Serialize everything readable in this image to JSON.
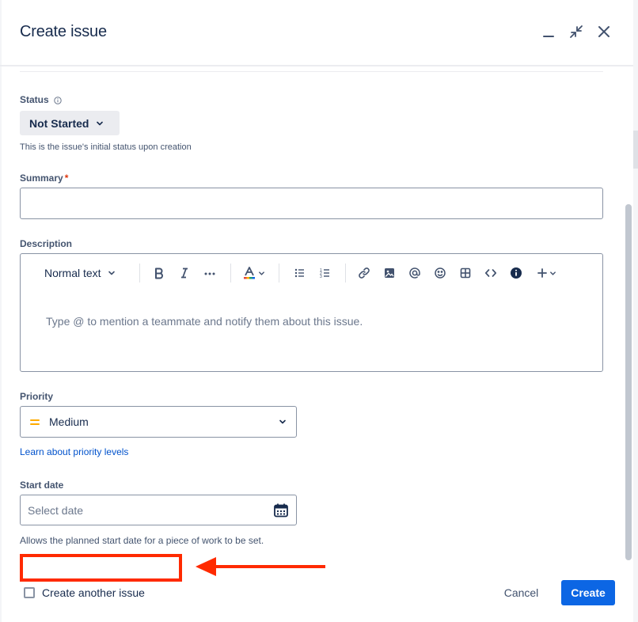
{
  "header": {
    "title": "Create issue",
    "icons": [
      "minimize-icon",
      "collapse-icon",
      "close-icon"
    ]
  },
  "status": {
    "label": "Status",
    "value": "Not Started",
    "help": "This is the issue's initial status upon creation"
  },
  "summary": {
    "label": "Summary",
    "required_mark": "*",
    "value": ""
  },
  "description": {
    "label": "Description",
    "text_style": "Normal text",
    "placeholder": "Type @ to mention a teammate and notify them about this issue.",
    "toolbar_icons": [
      "bold-icon",
      "italic-icon",
      "more-formatting-icon",
      "text-color-icon",
      "bullet-list-icon",
      "numbered-list-icon",
      "link-icon",
      "image-icon",
      "mention-icon",
      "emoji-icon",
      "table-icon",
      "code-icon",
      "info-panel-icon",
      "insert-icon"
    ]
  },
  "priority": {
    "label": "Priority",
    "value": "Medium",
    "color": "#ffab00",
    "link": "Learn about priority levels"
  },
  "start_date": {
    "label": "Start date",
    "placeholder": "Select date",
    "help": "Allows the planned start date for a piece of work to be set."
  },
  "footer": {
    "create_another": "Create another issue",
    "cancel": "Cancel",
    "create": "Create"
  },
  "colors": {
    "primary": "#0c66e4",
    "annotation": "#ff2a00",
    "required": "#de350b"
  }
}
